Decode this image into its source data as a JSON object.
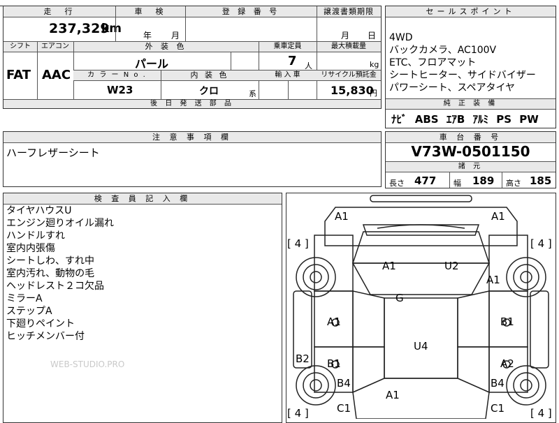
{
  "header": {
    "mileage_label": "走　行",
    "inspection_label": "車　検",
    "registration_label": "登 録 番 号",
    "transfer_label": "譲渡書類期限",
    "sales_point_label": "セールスポイント"
  },
  "vehicle": {
    "mileage": "237,329",
    "mileage_unit": "km",
    "inspection_year": "年",
    "inspection_month": "月",
    "transfer_month": "月",
    "transfer_day": "日",
    "shift_label": "シフト",
    "ac_label": "エアコン",
    "shift": "FAT",
    "ac": "AAC",
    "ext_color_label": "外 装 色",
    "ext_color": "パール",
    "capacity_label": "乗車定員",
    "capacity": "7",
    "capacity_unit": "人",
    "max_load_label": "最大積載量",
    "max_load_unit": "kg",
    "color_no_label": "カ ラ ー N o .",
    "color_no": "W23",
    "int_color_label": "内 装 色",
    "int_color": "クロ",
    "int_color_suffix": "系",
    "import_label": "輸 入 車",
    "recycle_label": "リサイクル預託金",
    "recycle_fee": "15,830",
    "recycle_unit": "円",
    "later_parts_label": "後 日 発 送 部 品"
  },
  "sales_points": [
    "4WD",
    "バックカメラ、AC100V",
    "ETC、フロアマット",
    "シートヒーター、サイドバイザー",
    "パワーシート、スペアタイヤ"
  ],
  "equipment": {
    "label": "純 正 装 備",
    "items": [
      "ﾅﾋﾞ",
      "ABS",
      "ｴｱB",
      "ｱﾙﾐ",
      "PS",
      "PW"
    ]
  },
  "notes": {
    "label": "注 意 事 項 欄",
    "text": "ハーフレザーシート"
  },
  "chassis": {
    "label": "車 台 番 号",
    "number": "V73W-0501150"
  },
  "dimensions": {
    "label": "諸 元",
    "length_label": "長さ",
    "length": "477",
    "width_label": "幅",
    "width": "189",
    "height_label": "高さ",
    "height": "185"
  },
  "inspector": {
    "label": "検 査 員 記 入 欄",
    "lines": [
      "タイヤハウスU",
      "エンジン廻りオイル漏れ",
      "ハンドルすれ",
      "室内内張傷",
      "シートしわ、すれ中",
      "室内汚れ、動物の毛",
      "ヘッドレスト２コ欠品",
      "ミラーA",
      "ステップA",
      "下廻りペイント",
      "ヒッチメンバー付"
    ],
    "watermark": "WEB-STUDIO.PRO"
  },
  "diagram": {
    "tires": [
      "[ 4 ]",
      "[ 4 ]",
      "[ 4 ]",
      "[ 4 ]"
    ],
    "grades": {
      "front_left": "A1",
      "front_right": "A1",
      "hood_left": "A1",
      "hood_right": "U2",
      "fender_right": "A1",
      "windshield": "G",
      "door_fl": "A1",
      "door_fr": "B1",
      "roof": "U4",
      "side_left": "B2",
      "door_rl": "B1",
      "door_rr": "A2",
      "rear_left": "B4",
      "rear_right": "B4",
      "back_center": "A1",
      "corner_rl": "C1",
      "corner_rr": "C1"
    }
  }
}
